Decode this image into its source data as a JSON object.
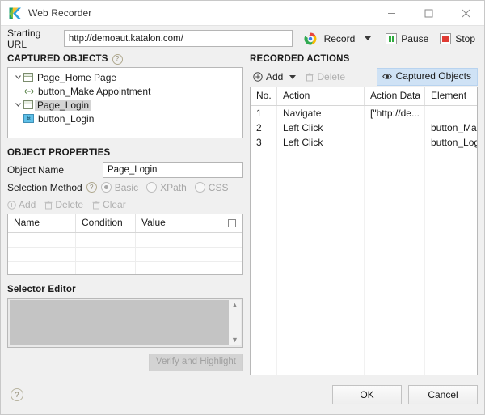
{
  "window": {
    "title": "Web Recorder",
    "app_icon": "katalon-logo-icon",
    "minimize_label": "Minimize",
    "maximize_label": "Maximize",
    "close_label": "Close"
  },
  "url_bar": {
    "label": "Starting URL",
    "value": "http://demoaut.katalon.com/",
    "placeholder": "http://"
  },
  "recorder_controls": {
    "browser_icon": "chrome-icon",
    "record_label": "Record",
    "record_caret": "▾",
    "pause_label": "Pause",
    "stop_label": "Stop",
    "pause_color": "#2faa3e",
    "stop_color": "#e03b34"
  },
  "captured_objects": {
    "heading": "CAPTURED OBJECTS",
    "help": "?",
    "tree": [
      {
        "label": "Page_Home Page",
        "icon": "page-icon",
        "expanded": true,
        "twisty": "chevron-down-icon",
        "selected": false,
        "children": [
          {
            "label": "button_Make Appointment",
            "icon": "link-icon",
            "selected": false
          }
        ]
      },
      {
        "label": "Page_Login",
        "icon": "page-icon",
        "expanded": true,
        "twisty": "chevron-down-icon",
        "selected": true,
        "children": [
          {
            "label": "button_Login",
            "icon": "button-element-icon",
            "selected": false
          }
        ]
      }
    ]
  },
  "object_properties": {
    "heading": "OBJECT PROPERTIES",
    "object_name_label": "Object Name",
    "object_name_value": "Page_Login",
    "selection_method_label": "Selection Method",
    "selection_method_help": "?",
    "selection_options": [
      {
        "label": "Basic",
        "selected": true
      },
      {
        "label": "XPath",
        "selected": false
      },
      {
        "label": "CSS",
        "selected": false
      }
    ],
    "toolbar": [
      {
        "label": "Add",
        "icon": "plus-circle-icon",
        "enabled": false
      },
      {
        "label": "Delete",
        "icon": "trash-icon",
        "enabled": false
      },
      {
        "label": "Clear",
        "icon": "trash-icon",
        "enabled": false
      }
    ],
    "table": {
      "columns": [
        "Name",
        "Condition",
        "Value",
        ""
      ],
      "header_checkbox": false,
      "rows": []
    }
  },
  "selector_editor": {
    "heading": "Selector Editor",
    "value": "",
    "enabled": false,
    "scroll_up": "▲",
    "scroll_down": "▼",
    "verify_label": "Verify and Highlight"
  },
  "recorded_actions": {
    "heading": "RECORDED ACTIONS",
    "toolbar": {
      "add_label": "Add",
      "add_icon": "plus-circle-icon",
      "add_caret": "▾",
      "delete_label": "Delete",
      "delete_icon": "trash-icon",
      "delete_enabled": false,
      "captured_objects_label": "Captured Objects",
      "captured_objects_icon": "eye-icon",
      "captured_objects_active": true
    },
    "columns": [
      "No.",
      "Action",
      "Action Data",
      "Element"
    ],
    "rows": [
      {
        "no": "1",
        "action": "Navigate",
        "action_data": "[\"http://de...",
        "element": ""
      },
      {
        "no": "2",
        "action": "Left Click",
        "action_data": "",
        "element": "button_Ma..."
      },
      {
        "no": "3",
        "action": "Left Click",
        "action_data": "",
        "element": "button_Log..."
      }
    ]
  },
  "footer": {
    "help_icon": "help-circle-icon",
    "help": "?",
    "ok_label": "OK",
    "cancel_label": "Cancel"
  }
}
